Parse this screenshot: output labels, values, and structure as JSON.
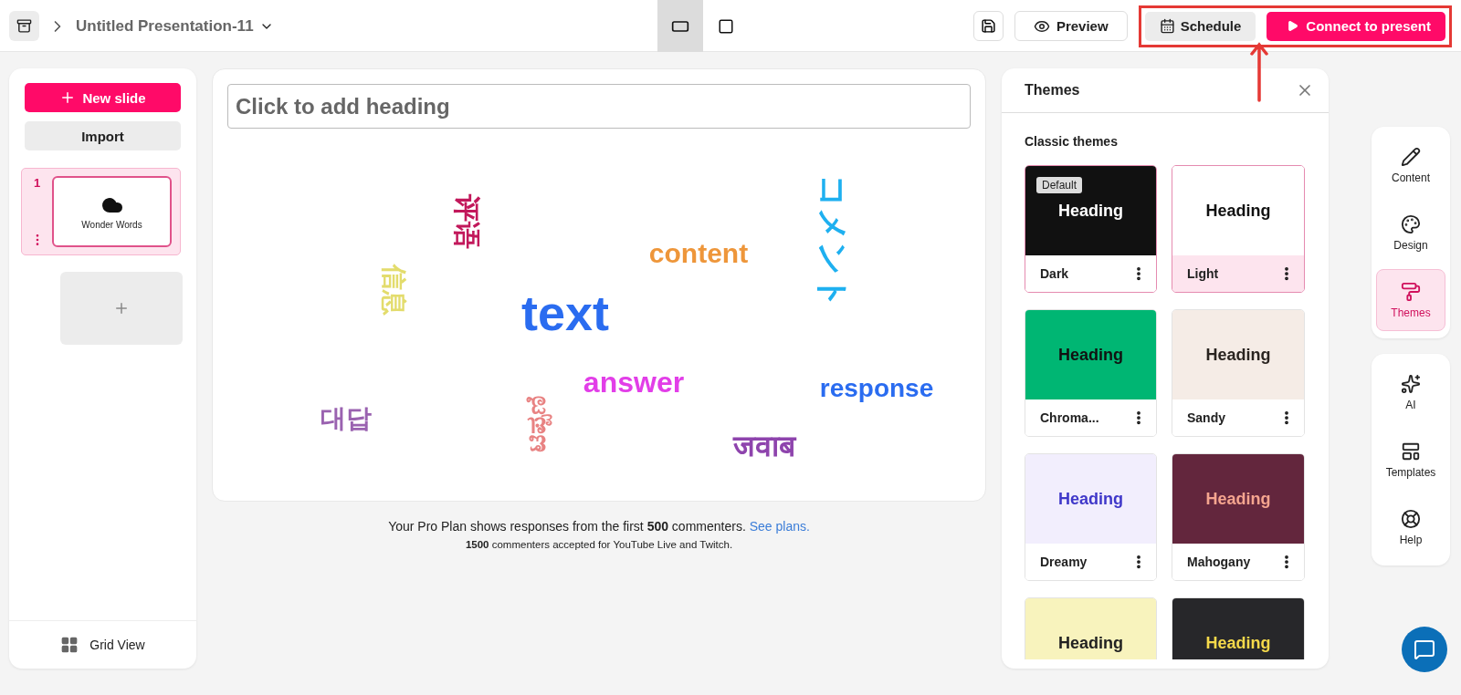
{
  "header": {
    "title": "Untitled Presentation-11",
    "view_modes": [
      {
        "kind": "wide",
        "selected": true
      },
      {
        "kind": "square",
        "selected": false
      }
    ],
    "preview": "Preview",
    "schedule": "Schedule",
    "present": "Connect to present"
  },
  "slides_panel": {
    "new_slide": "New slide",
    "import": "Import",
    "slides": [
      {
        "number": "1",
        "title": "Wonder Words",
        "selected": true
      }
    ],
    "grid_view": "Grid View"
  },
  "editor": {
    "heading_placeholder": "Click to add heading",
    "words": [
      {
        "text": "评语",
        "color": "#c2185b",
        "kind": "down"
      },
      {
        "text": "信息",
        "color": "#e3dc6c",
        "kind": "down"
      },
      {
        "text": "content",
        "color": "#ee963a",
        "kind": "flat"
      },
      {
        "text": "text",
        "color": "#2a6cf0",
        "kind": "flat"
      },
      {
        "text": "コメント",
        "color": "#1eb0f0",
        "kind": "down"
      },
      {
        "text": "answer",
        "color": "#e23ee8",
        "kind": "flat"
      },
      {
        "text": "response",
        "color": "#2a6cf0",
        "kind": "flat"
      },
      {
        "text": "대답",
        "color": "#9a62b0",
        "kind": "flat"
      },
      {
        "text": "ಟಿಪ್ಪಣಿ",
        "color": "#e88282",
        "kind": "up"
      },
      {
        "text": "जवाब",
        "color": "#8e44ad",
        "kind": "flat"
      }
    ],
    "notice": "Your Pro Plan shows responses from the first **500** commenters.",
    "notice_link": "See plans.",
    "sub_notice": "**1500** commenters accepted for YouTube Live and Twitch."
  },
  "themes_panel": {
    "title": "Themes",
    "section": "Classic themes",
    "themes": [
      {
        "name": "Dark",
        "heading": {
          "text": "Heading",
          "color": "#ffffff"
        },
        "color": "#111111",
        "badge": "Default",
        "selected": false
      },
      {
        "name": "Light",
        "heading": {
          "text": "Heading",
          "color": "#111111"
        },
        "color": "#ffffff",
        "selected": true
      },
      {
        "name": "Chroma...",
        "heading": {
          "text": "Heading",
          "color": "#111111"
        },
        "color": "#00b673",
        "selected": false
      },
      {
        "name": "Sandy",
        "heading": {
          "text": "Heading",
          "color": "#2a2420"
        },
        "color": "#f5ece6",
        "selected": false
      },
      {
        "name": "Dreamy",
        "heading": {
          "text": "Heading",
          "color": "#3f37c9"
        },
        "color": "#f2eefd",
        "selected": false
      },
      {
        "name": "Mahogany",
        "heading": {
          "text": "Heading",
          "color": "#f5a58f"
        },
        "color": "#63263d",
        "selected": false
      },
      {
        "heading": {
          "text": "Heading",
          "color": "#222222"
        },
        "color": "#f8f3bd",
        "selected": false
      },
      {
        "heading": {
          "text": "Heading",
          "color": "#f5d94a"
        },
        "color": "#27272a",
        "selected": false
      }
    ]
  },
  "rail": {
    "groups": [
      [
        {
          "label": "Content",
          "kind": "content",
          "selected": false
        },
        {
          "label": "Design",
          "kind": "design",
          "selected": false
        },
        {
          "label": "Themes",
          "kind": "themes",
          "selected": true
        }
      ],
      [
        {
          "label": "AI",
          "kind": "ai",
          "selected": false
        },
        {
          "label": "Templates",
          "kind": "templates",
          "selected": false
        },
        {
          "label": "Help",
          "kind": "help",
          "selected": false
        }
      ]
    ]
  }
}
